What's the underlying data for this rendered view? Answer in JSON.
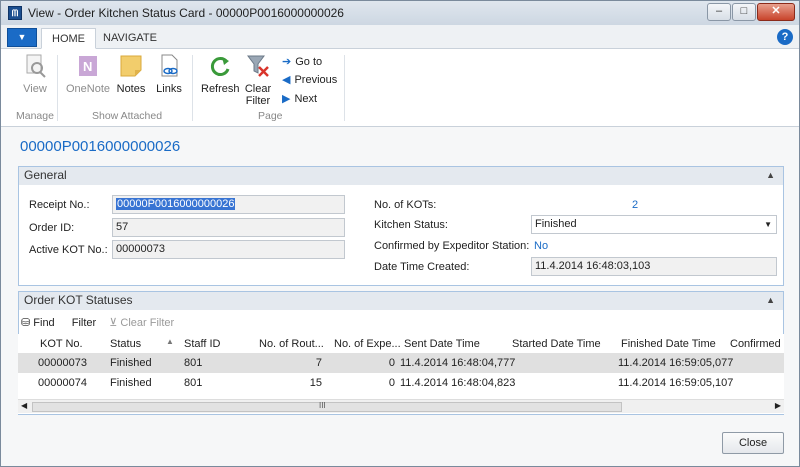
{
  "window": {
    "app_icon": "nav-logo-icon",
    "title": "View - Order Kitchen Status Card - 00000P0016000000026",
    "minimize": "–",
    "maximize": "□",
    "close": "✕"
  },
  "tabs": {
    "file_arrow": "▼",
    "home": "HOME",
    "navigate": "NAVIGATE",
    "help": "?"
  },
  "ribbon": {
    "view": "View",
    "onenote": "OneNote",
    "notes": "Notes",
    "links": "Links",
    "refresh": "Refresh",
    "clear_filter_1": "Clear",
    "clear_filter_2": "Filter",
    "goto": "Go to",
    "previous": "Previous",
    "next": "Next",
    "group_manage": "Manage",
    "group_show_attached": "Show Attached",
    "group_page": "Page"
  },
  "page_title": "00000P0016000000026",
  "general": {
    "header": "General",
    "receipt_label": "Receipt No.:",
    "receipt_value": "00000P0016000000026",
    "order_id_label": "Order ID:",
    "order_id_value": "57",
    "active_kot_label": "Active KOT No.:",
    "active_kot_value": "00000073",
    "no_kots_label": "No. of KOTs:",
    "no_kots_value": "2",
    "kitchen_status_label": "Kitchen Status:",
    "kitchen_status_value": "Finished",
    "confirmed_label": "Confirmed by Expeditor Station:",
    "confirmed_value": "No",
    "created_label": "Date Time Created:",
    "created_value": "11.4.2014 16:48:03,103"
  },
  "kot": {
    "header": "Order KOT Statuses",
    "find": "Find",
    "filter": "Filter",
    "clear_filter": "Clear Filter",
    "columns": [
      "KOT No.",
      "Status",
      "Staff ID",
      "No. of Rout...",
      "No. of Expe...",
      "Sent Date Time",
      "Started Date Time",
      "Finished Date Time",
      "Confirmed D"
    ],
    "rows": [
      [
        "00000073",
        "Finished",
        "801",
        "7",
        "0",
        "11.4.2014 16:48:04,777",
        "",
        "11.4.2014 16:59:05,077",
        ""
      ],
      [
        "00000074",
        "Finished",
        "801",
        "15",
        "0",
        "11.4.2014 16:48:04,823",
        "",
        "11.4.2014 16:59:05,107",
        ""
      ]
    ],
    "scroll_mid": "III"
  },
  "close_button": "Close"
}
